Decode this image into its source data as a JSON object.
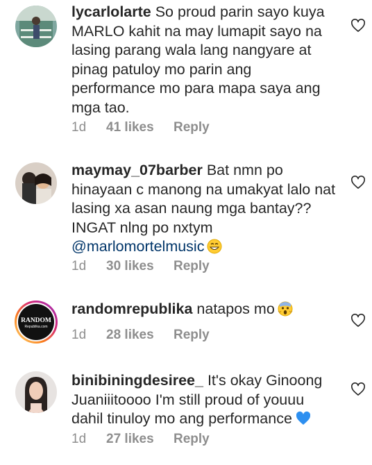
{
  "comments": [
    {
      "username": "lycarlolarte",
      "text": "So proud parin sayo kuya MARLO kahit na may lumapit sayo na lasing parang wala lang nangyare at pinag patuloy mo parin ang performance mo para mapa saya ang mga tao.",
      "time": "1d",
      "likes": "41 likes",
      "reply": "Reply",
      "avatar_icon": "profile-photo-outdoor"
    },
    {
      "username": "maymay_07barber",
      "text": "Bat nmn po hinayaan c manong na umakyat lalo nat lasing xa asan naung mga bantay?? INGAT nlng po nxtym",
      "mention": "@marlomortelmusic",
      "emoji": "grinning-face-emoji",
      "time": "1d",
      "likes": "30 likes",
      "reply": "Reply",
      "avatar_icon": "profile-photo-couple"
    },
    {
      "username": "randomrepublika",
      "text": "natapos mo",
      "emoji": "face-screaming-emoji",
      "time": "1d",
      "likes": "28 likes",
      "reply": "Reply",
      "avatar_icon": "random-republika-logo",
      "avatar_logo_text": [
        "RANDOM",
        "Republika.com"
      ]
    },
    {
      "username": "binibiningdesiree_",
      "text": "It's okay Ginoong Juaniiitoooo I'm still proud of youuu dahil tinuloy mo ang performance",
      "emoji": "blue-heart-emoji",
      "time": "1d",
      "likes": "27 likes",
      "reply": "Reply",
      "avatar_icon": "profile-photo-woman"
    }
  ],
  "colors": {
    "text": "#262626",
    "meta": "#8e8e8e",
    "mention": "#003569",
    "story_ring": "#d6249f"
  }
}
